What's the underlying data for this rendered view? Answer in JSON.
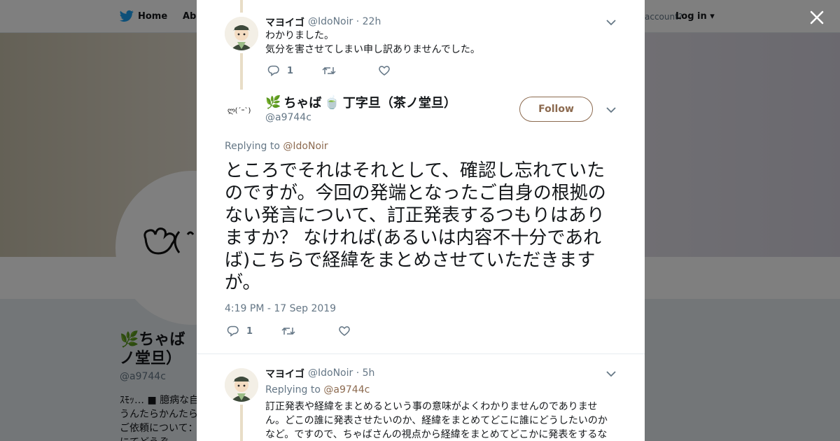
{
  "background": {
    "nav": {
      "home": "Home",
      "about": "Abo",
      "account": "account?",
      "login": "Log in"
    },
    "profile": {
      "name": "🌿ちゃば 🍵丁字旦（茶ノ堂旦）",
      "name_visible": "ちゃば\nノ堂旦）",
      "handle": "@a9744c",
      "bio": "ｽﾓｯ… ■ 臆病な自\nうんたらかんたら\nご依頼について：\nにてどうぞ"
    }
  },
  "modal": {
    "parent_tweet": {
      "name": "マヨイゴ",
      "handle": "@IdoNoir",
      "time": "22h",
      "line1": "わかりました。",
      "line2": "気分を害させてしまい申し訳ありませんでした。",
      "reply_count": "1",
      "retweet_count": "",
      "like_count": ""
    },
    "main_tweet": {
      "name": "ちゃば 🍵 丁字旦（茶ノ堂旦）",
      "name_prefix": "ちゃば",
      "name_suffix": "丁字旦（茶ノ堂旦）",
      "handle": "@a9744c",
      "follow_label": "Follow",
      "replying_label": "Replying to",
      "replying_to": "@IdoNoir",
      "text": "ところでそれはそれとして、確認し忘れていたのですが。今回の発端となったご自身の根拠のない発言について、訂正発表するつもりはありますか？ なければ(あるいは内容不十分であれば)こちらで経緯をまとめさせていただきますが。",
      "timestamp": "4:19 PM - 17 Sep 2019",
      "reply_count": "1",
      "retweet_count": "",
      "like_count": ""
    },
    "reply_tweet": {
      "name": "マヨイゴ",
      "handle": "@IdoNoir",
      "time": "5h",
      "replying_label": "Replying to",
      "replying_to": "@a9744c",
      "text": "訂正発表や経緯をまとめるという事の意味がよくわかりませんのでありません。どこの誰に発表させたいのか、経緯をまとめてどこに誰にどうしたいのかなど。ですので、ちゃばさんの視点から経緯をまとめてどこかに発表をするな"
    }
  },
  "colors": {
    "accent": "#8c6a4f",
    "thread_line": "#e8ddc7",
    "muted": "#657786"
  },
  "icons": [
    "twitter-bird-icon",
    "close-icon",
    "chevron-down-icon",
    "reply-icon",
    "retweet-icon",
    "like-icon",
    "leaf-icon",
    "tea-bowl-icon"
  ]
}
